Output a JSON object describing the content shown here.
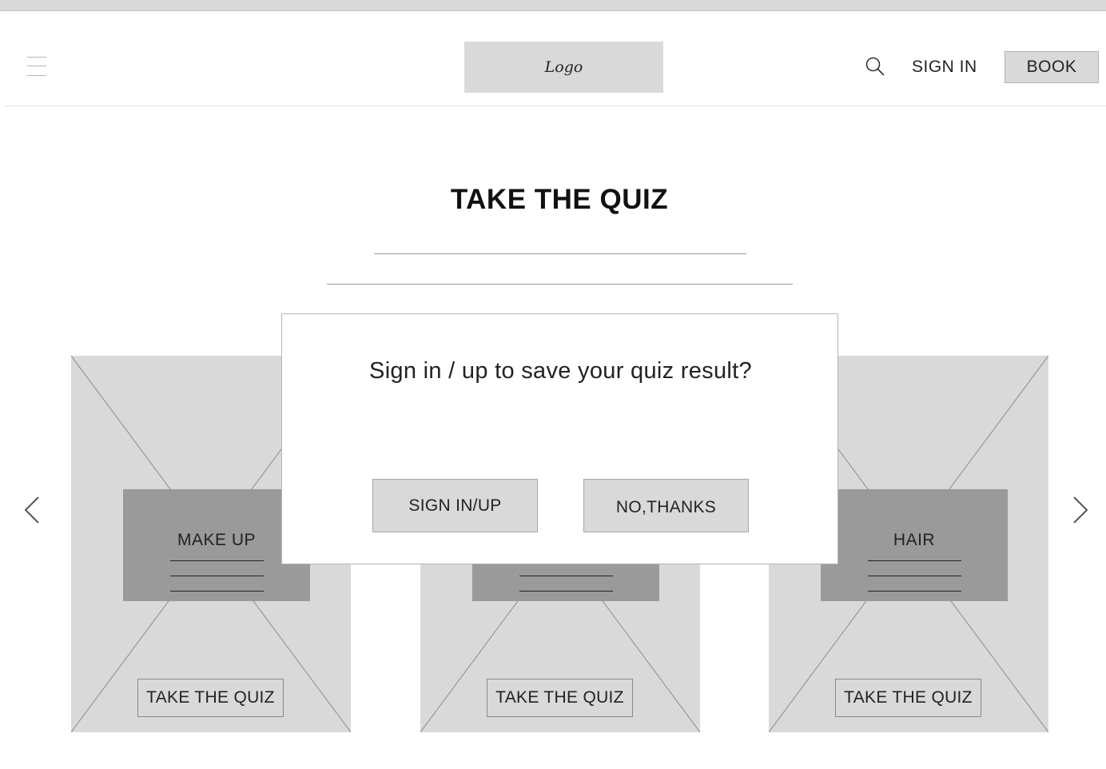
{
  "header": {
    "menu_icon": "hamburger-menu-icon",
    "logo_text": "Logo",
    "search_icon": "search-icon",
    "sign_in_label": "SIGN IN",
    "book_label": "BOOK"
  },
  "main": {
    "title": "TAKE THE QUIZ"
  },
  "carousel": {
    "prev_icon": "chevron-left-icon",
    "next_icon": "chevron-right-icon",
    "cards": [
      {
        "label": "MAKE UP",
        "button_label": "TAKE THE QUIZ"
      },
      {
        "label": "",
        "button_label": "TAKE THE QUIZ"
      },
      {
        "label": "HAIR",
        "button_label": "TAKE THE QUIZ"
      }
    ]
  },
  "modal": {
    "message": "Sign in / up to save your quiz result?",
    "confirm_label": "SIGN IN/UP",
    "dismiss_label": "NO,THANKS"
  },
  "colors": {
    "placeholder_gray": "#d9d9d9",
    "panel_gray": "#9a9a9a",
    "background": "#ffffff",
    "text": "#222222"
  }
}
